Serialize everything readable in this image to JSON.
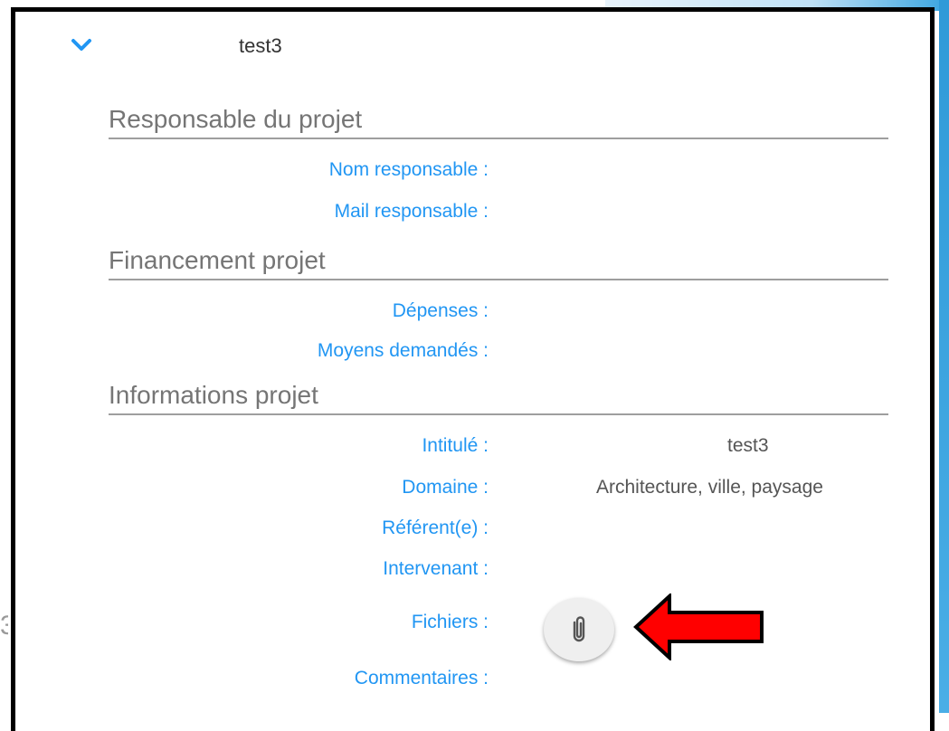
{
  "item": {
    "title": "test3"
  },
  "side_digit": "3",
  "sections": {
    "responsable": {
      "title": "Responsable du projet",
      "nom_label": "Nom responsable :",
      "mail_label": "Mail responsable :"
    },
    "financement": {
      "title": "Financement projet",
      "depenses_label": "Dépenses :",
      "moyens_label": "Moyens demandés :"
    },
    "informations": {
      "title": "Informations projet",
      "intitule_label": "Intitulé :",
      "intitule_value": "test3",
      "domaine_label": "Domaine :",
      "domaine_value": "Architecture, ville, paysage",
      "referent_label": "Référent(e) :",
      "intervenant_label": "Intervenant :",
      "fichiers_label": "Fichiers :",
      "commentaires_label": "Commentaires :"
    }
  },
  "icons": {
    "expand": "chevron-down-icon",
    "attach": "paperclip-icon",
    "annotation": "red-arrow-left"
  },
  "colors": {
    "label": "#2196f3",
    "arrow": "#ff0000",
    "chevron": "#2196f3"
  }
}
